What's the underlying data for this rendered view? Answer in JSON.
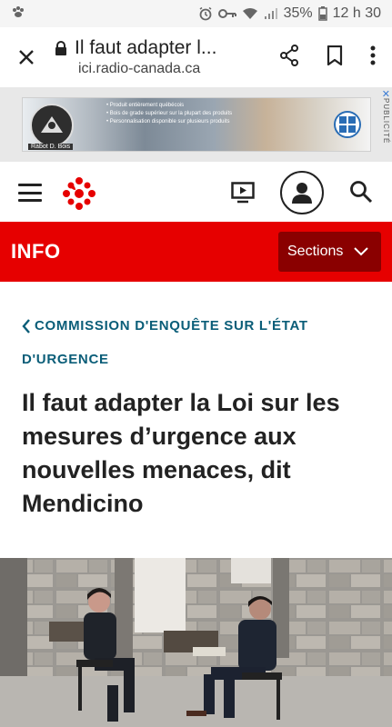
{
  "status_bar": {
    "battery": "35%",
    "time": "12 h 30",
    "icons": [
      "paw-icon",
      "alarm-icon",
      "key-icon",
      "wifi-icon",
      "signal-icon",
      "battery-icon"
    ]
  },
  "browser": {
    "page_title": "Il faut adapter l...",
    "host": "ici.radio-canada.ca",
    "icons": [
      "close-icon",
      "lock-icon",
      "share-icon",
      "bookmark-icon",
      "more-vert-icon"
    ]
  },
  "ad": {
    "label": "PUBLICITÉ",
    "logo_caption": "Rabot D. Bois",
    "lines": [
      "• Produit entièrement québécois",
      "• Bois de grade supérieur sur la plupart des produits",
      "• Personnalisation disponible sur plusieurs produits"
    ],
    "close_glyph": "✕"
  },
  "site_header": {
    "icons": [
      "menu-icon",
      "radio-canada-gem-icon",
      "tv-play-icon",
      "account-icon",
      "search-icon"
    ]
  },
  "section_bar": {
    "title": "INFO",
    "sections_label": "Sections",
    "accent": "#e60000",
    "button_color": "#8a0000"
  },
  "article": {
    "breadcrumb": "COMMISSION D'ENQUÊTE SUR L'ÉTAT D'URGENCE",
    "headline": "Il faut adapter la Loi sur les mesures d’urgence aux nouvelles menaces, dit Mendicino",
    "link_color": "#0a5d78"
  }
}
